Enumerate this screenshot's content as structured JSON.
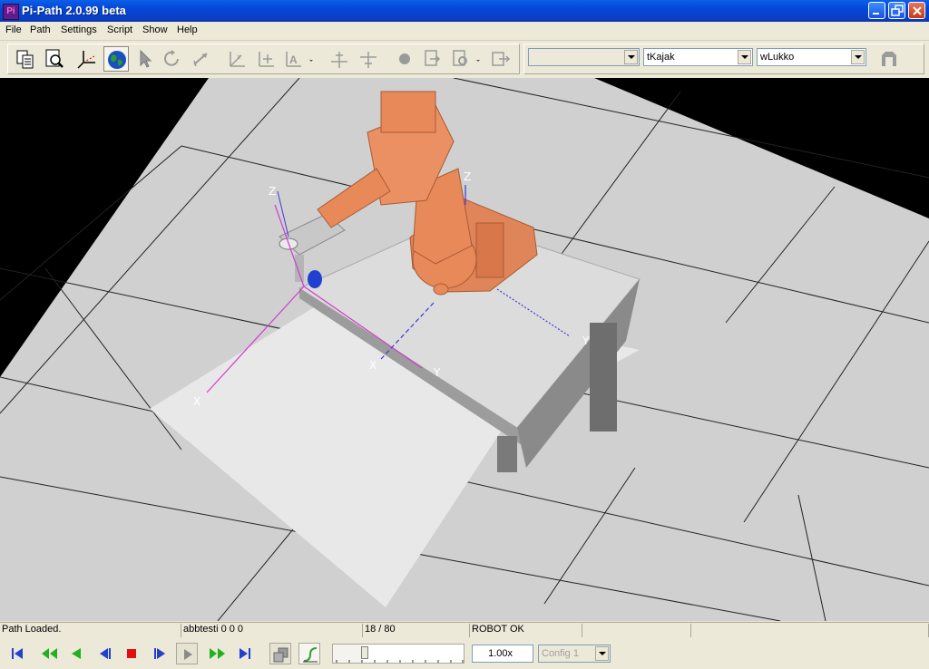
{
  "window": {
    "title": "Pi-Path 2.0.99 beta",
    "logo_text": "Pi"
  },
  "menu": [
    "File",
    "Path",
    "Settings",
    "Script",
    "Show",
    "Help"
  ],
  "toolbar": {
    "combo_1": {
      "value": ""
    },
    "combo_tool": {
      "value": "tKajak"
    },
    "combo_workobject": {
      "value": "wLukko"
    }
  },
  "viewport": {
    "axes_labels": {
      "x1": "X",
      "y1": "Y",
      "z1": "Z",
      "x2": "X",
      "y2": "Y",
      "z2": "Z",
      "y3": "Y"
    },
    "colors": {
      "floor": "#e8e8e8",
      "grid_tile": "#d6d6d6",
      "robot": "#e8895a",
      "table": "#dcdcdc",
      "axis_magenta": "#d23bd2",
      "axis_blue": "#3b3bd6"
    }
  },
  "status": {
    "message": "Path Loaded.",
    "program": "abbtesti 0 0 0",
    "position": "18 / 80",
    "robot_state": "ROBOT OK"
  },
  "playback": {
    "progress": 0.225,
    "speed": "1.00x",
    "config": "Config 1"
  }
}
